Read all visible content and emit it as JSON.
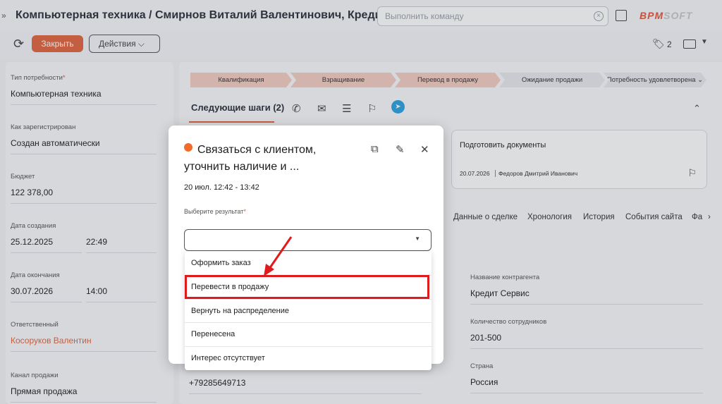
{
  "header": {
    "title": "Компьютерная техника / Смирнов Виталий Валентинович, Кредит Сервис",
    "command_placeholder": "Выполнить команду",
    "logo_main": "BPM",
    "logo_tail": "SOFT"
  },
  "toolbar": {
    "close_label": "Закрыть",
    "actions_label": "Действия ⌵",
    "tags_count": "2"
  },
  "left_fields": [
    {
      "label": "Тип потребности",
      "required": "*",
      "value": "Компьютерная техника"
    },
    {
      "label": "Как зарегистрирован",
      "value": "Создан автоматически"
    },
    {
      "label": "Бюджет",
      "value": "122 378,00"
    },
    {
      "label": "Дата создания",
      "date": "25.12.2025",
      "time": "22:49"
    },
    {
      "label": "Дата окончания",
      "date": "30.07.2026",
      "time": "14:00"
    },
    {
      "label": "Ответственный",
      "value": "Косоруков Валентин"
    },
    {
      "label": "Канал продажи",
      "value": "Прямая продажа"
    }
  ],
  "stages": [
    "Квалификация",
    "Взращивание",
    "Перевод в продажу",
    "Ожидание продажи",
    "Потребность удовлетворена ⌄"
  ],
  "next_steps": {
    "tab_label": "Следующие шаги (2)"
  },
  "card": {
    "title": "Подготовить документы",
    "date": "20.07.2026",
    "owner": "Федоров Дмитрий Иванович"
  },
  "tabs": [
    "Данные о сделке",
    "Хронология",
    "История",
    "События сайта",
    "Фа"
  ],
  "right_fields": [
    {
      "label": "Название контрагента",
      "value": "Кредит Сервис"
    },
    {
      "label": "Количество сотрудников",
      "value": "201-500"
    },
    {
      "label": "Страна",
      "value": "Россия"
    }
  ],
  "phone": "+79285649713",
  "popup": {
    "title": "Связаться с клиентом, уточнить наличие и ...",
    "time": "20 июл. 12:42 - 13:42",
    "result_label": "Выберите результат",
    "required": "*",
    "options": [
      "Оформить заказ",
      "Перевести в продажу",
      "Вернуть на распределение",
      "Перенесена",
      "Интерес отсутствует"
    ]
  },
  "colors": {
    "accent": "#e2653f",
    "highlight": "#e01b1b",
    "telegram": "#2aa3e0"
  }
}
